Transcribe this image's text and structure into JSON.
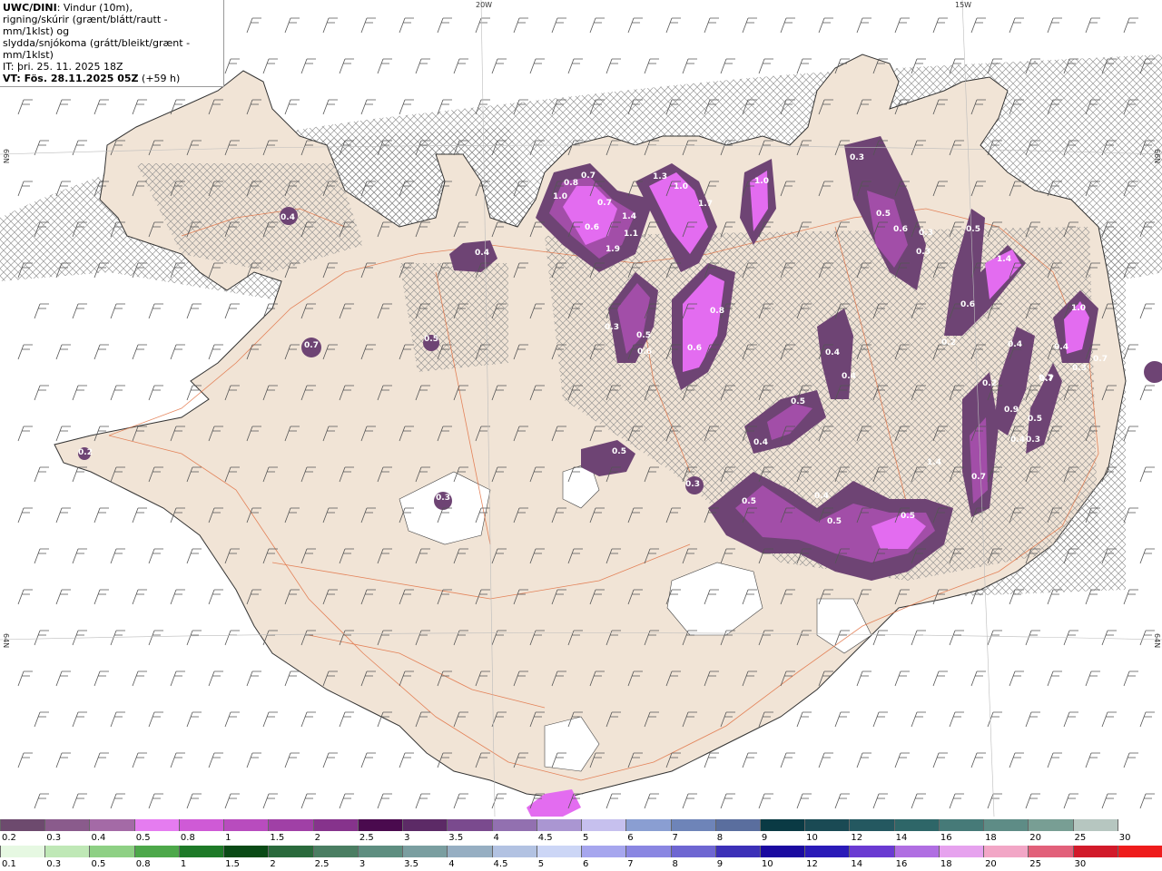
{
  "header": {
    "model": "UWC/DINI",
    "line1_rest": ": Vindur (10m),",
    "line2": "rigning/skúrir (grænt/blátt/rautt - mm/1klst) og",
    "line3": "slydda/snjókoma (grátt/bleikt/grænt - mm/1klst)",
    "init_time": "IT: þri. 25. 11. 2025 18Z",
    "valid_label": "VT: Fös. 28.11.2025 05Z",
    "valid_offset": " (+59 h)"
  },
  "grid_labels": {
    "lon_20w": "20W",
    "lon_15w": "15W",
    "lat_66n_left": "66N",
    "lat_66n_right": "66N",
    "lat_64n_left": "64N",
    "lat_64n_right": "64N"
  },
  "value_labels": [
    "0.7",
    "1.0",
    "0.8",
    "0.7",
    "0.6",
    "1.4",
    "1.1",
    "1.9",
    "1.3",
    "1.0",
    "1.7",
    "1.0",
    "0.3",
    "0.5",
    "0.6",
    "0.3",
    "0.3",
    "0.5",
    "1.4",
    "0.6",
    "1.0",
    "0.4",
    "0.2",
    "0.4",
    "0.7",
    "0.3",
    "0.7",
    "0.6",
    "0.8",
    "0.6",
    "0.4",
    "0.4",
    "0.3",
    "0.5",
    "0.4",
    "0.5",
    "0.3",
    "0.5",
    "0.4",
    "0.5",
    "0.5",
    "1.4",
    "0.7",
    "0.9",
    "0.4",
    "0.3",
    "0.5",
    "0.7",
    "0.5",
    "0.3",
    "0.4",
    "0.7",
    "0.5",
    "0.2",
    "0.4",
    "0.2"
  ],
  "colors": {
    "sea": "#ffffff",
    "land": "#f1e4d6",
    "roads": "#e06a3a",
    "precip_dark": "#6e4474",
    "precip_mid": "#a24ea8",
    "precip_light": "#e36cf0",
    "precip_peak": "#f29cf7"
  },
  "legend_top": {
    "labels": [
      "0.2",
      "0.3",
      "0.4",
      "0.5",
      "0.8",
      "1",
      "1.5",
      "2",
      "2.5",
      "3",
      "3.5",
      "4",
      "4.5",
      "5",
      "6",
      "7",
      "8",
      "9",
      "10",
      "12",
      "14",
      "16",
      "18",
      "20",
      "25",
      "30"
    ],
    "colors": [
      "#6d4a6e",
      "#8a5b8c",
      "#a46aa6",
      "#e57cf0",
      "#cf5ad6",
      "#b84cbe",
      "#a040a6",
      "#86338c",
      "#4a0a4e",
      "#5c2a66",
      "#7a4a8e",
      "#9270b0",
      "#aa96d2",
      "#c6c0ee",
      "#8a9ed2",
      "#6e84b8",
      "#5a6e9e",
      "#0a3a44",
      "#1a4a54",
      "#245860",
      "#2e6668",
      "#467a78",
      "#5e8c86",
      "#789e94",
      "#b6c6c0",
      "#ffffff"
    ]
  },
  "legend_bottom": {
    "labels": [
      "0.1",
      "0.3",
      "0.5",
      "0.8",
      "1",
      "1.5",
      "2",
      "2.5",
      "3",
      "3.5",
      "4",
      "4.5",
      "5",
      "6",
      "7",
      "8",
      "9",
      "10",
      "12",
      "14",
      "16",
      "18",
      "20",
      "25",
      "30"
    ],
    "colors": [
      "#e6f8e2",
      "#bfe8b6",
      "#8ed084",
      "#4da84a",
      "#1e7a28",
      "#0a4a16",
      "#2a6a3c",
      "#4a7e62",
      "#5e8e80",
      "#7a9ea0",
      "#96aec2",
      "#b2c2e2",
      "#ccd6f6",
      "#a6a6ee",
      "#8a86e2",
      "#6e66d2",
      "#3c30b8",
      "#1a0aa0",
      "#2a1ab8",
      "#6a3ad2",
      "#b06ee2",
      "#e6a2ee",
      "#f2a6c6",
      "#e2607a",
      "#d21a2a",
      "#ee1c1c"
    ]
  }
}
